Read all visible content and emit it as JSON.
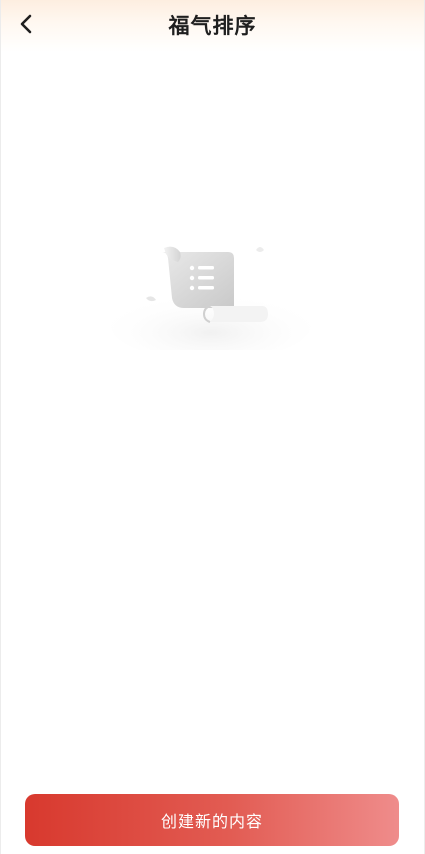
{
  "header": {
    "title": "福气排序",
    "back_icon": "chevron-left-icon"
  },
  "empty_state": {
    "illustration": "empty-list-scroll-icon"
  },
  "footer": {
    "create_label": "创建新的内容"
  },
  "colors": {
    "accent_start": "#d8392e",
    "accent_end": "#ef8c8b",
    "header_tint": "#fdeee0"
  }
}
